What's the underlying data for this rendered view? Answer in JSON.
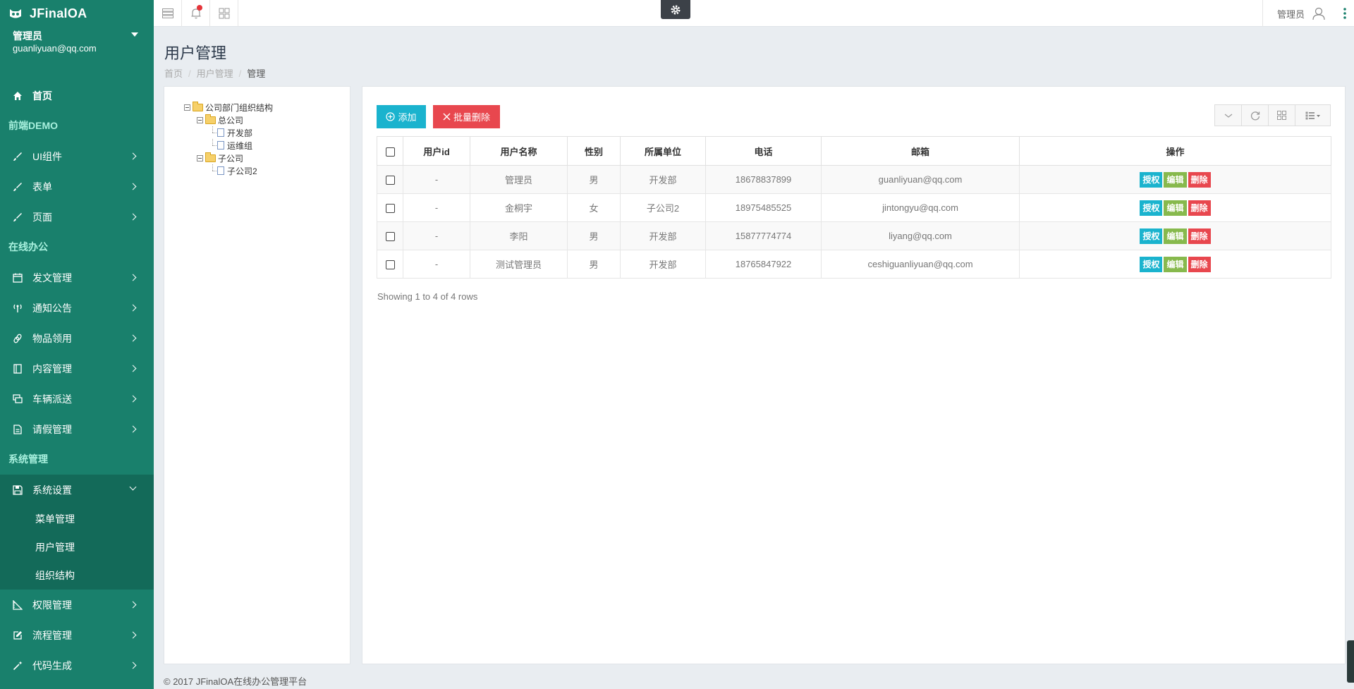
{
  "app": {
    "title": "JFinalOA"
  },
  "user": {
    "name": "管理员",
    "email": "guanliyuan@qq.com"
  },
  "sidebar": {
    "home": "首页",
    "section_demo": "前端DEMO",
    "demo_items": [
      {
        "label": "UI组件",
        "icon": "brush-icon"
      },
      {
        "label": "表单",
        "icon": "brush-icon"
      },
      {
        "label": "页面",
        "icon": "brush-icon"
      }
    ],
    "section_office": "在线办公",
    "office_items": [
      {
        "label": "发文管理",
        "icon": "calendar-icon"
      },
      {
        "label": "通知公告",
        "icon": "antenna-icon"
      },
      {
        "label": "物品领用",
        "icon": "link-icon"
      },
      {
        "label": "内容管理",
        "icon": "book-icon"
      },
      {
        "label": "车辆派送",
        "icon": "monitor-icon"
      },
      {
        "label": "请假管理",
        "icon": "document-icon"
      }
    ],
    "section_system": "系统管理",
    "system_settings": {
      "label": "系统设置",
      "icon": "save-icon"
    },
    "system_sub": [
      "菜单管理",
      "用户管理",
      "组织结构"
    ],
    "system_items": [
      {
        "label": "权限管理",
        "icon": "ruler-icon"
      },
      {
        "label": "流程管理",
        "icon": "edit-icon"
      },
      {
        "label": "代码生成",
        "icon": "wand-icon"
      }
    ]
  },
  "topbar": {
    "user_label": "管理员"
  },
  "page": {
    "title": "用户管理",
    "breadcrumb": [
      "首页",
      "用户管理",
      "管理"
    ]
  },
  "tree": {
    "root": "公司部门组织结构",
    "head_office": "总公司",
    "head_children": [
      "开发部",
      "运维组"
    ],
    "sub_company": "子公司",
    "sub_children": [
      "子公司2"
    ]
  },
  "toolbar": {
    "add_label": "添加",
    "batch_delete_label": "批量删除"
  },
  "table": {
    "headers": [
      "用户id",
      "用户名称",
      "性别",
      "所属单位",
      "电话",
      "邮箱",
      "操作"
    ],
    "rows": [
      {
        "id": "-",
        "name": "管理员",
        "gender": "男",
        "unit": "开发部",
        "phone": "18678837899",
        "email": "guanliyuan@qq.com"
      },
      {
        "id": "-",
        "name": "金桐宇",
        "gender": "女",
        "unit": "子公司2",
        "phone": "18975485525",
        "email": "jintongyu@qq.com"
      },
      {
        "id": "-",
        "name": "李阳",
        "gender": "男",
        "unit": "开发部",
        "phone": "15877774774",
        "email": "liyang@qq.com"
      },
      {
        "id": "-",
        "name": "测试管理员",
        "gender": "男",
        "unit": "开发部",
        "phone": "18765847922",
        "email": "ceshiguanliyuan@qq.com"
      }
    ],
    "actions": {
      "auth": "授权",
      "edit": "编辑",
      "delete": "删除"
    },
    "pagination_info": "Showing 1 to 4 of 4 rows"
  },
  "footer": {
    "text": "© 2017 JFinalOA在线办公管理平台"
  },
  "colors": {
    "sidebar_bg": "#19806c",
    "accent_cyan": "#1ab3ce",
    "danger": "#e8474e",
    "success": "#87b94d"
  }
}
